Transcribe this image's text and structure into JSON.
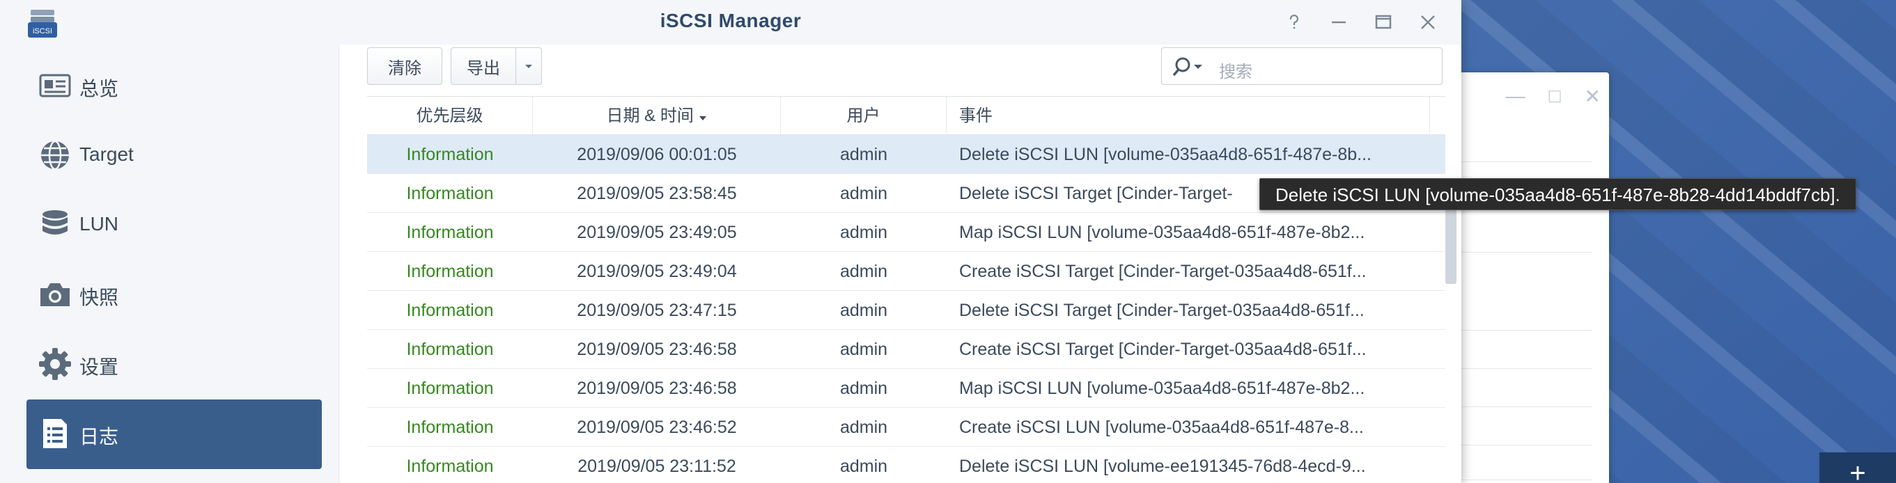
{
  "window": {
    "title": "iSCSI Manager",
    "app_icon_text": "iSCSI"
  },
  "sidebar": {
    "items": [
      {
        "label": "总览",
        "icon": "overview-card-icon"
      },
      {
        "label": "Target",
        "icon": "globe-icon"
      },
      {
        "label": "LUN",
        "icon": "database-icon"
      },
      {
        "label": "快照",
        "icon": "camera-icon"
      },
      {
        "label": "设置",
        "icon": "gear-icon"
      },
      {
        "label": "日志",
        "icon": "log-document-icon",
        "active": true
      }
    ]
  },
  "toolbar": {
    "clear_label": "清除",
    "export_label": "导出",
    "search_placeholder": "搜索"
  },
  "table": {
    "columns": [
      "优先层级",
      "日期 & 时间",
      "用户",
      "事件"
    ],
    "sort_column": "日期 & 时间",
    "rows": [
      {
        "priority": "Information",
        "time": "2019/09/06 00:01:05",
        "user": "admin",
        "event": "Delete iSCSI LUN [volume-035aa4d8-651f-487e-8b...",
        "selected": true
      },
      {
        "priority": "Information",
        "time": "2019/09/05 23:58:45",
        "user": "admin",
        "event": "Delete iSCSI Target [Cinder-Target-"
      },
      {
        "priority": "Information",
        "time": "2019/09/05 23:49:05",
        "user": "admin",
        "event": "Map iSCSI LUN [volume-035aa4d8-651f-487e-8b2..."
      },
      {
        "priority": "Information",
        "time": "2019/09/05 23:49:04",
        "user": "admin",
        "event": "Create iSCSI Target [Cinder-Target-035aa4d8-651f..."
      },
      {
        "priority": "Information",
        "time": "2019/09/05 23:47:15",
        "user": "admin",
        "event": "Delete iSCSI Target [Cinder-Target-035aa4d8-651f..."
      },
      {
        "priority": "Information",
        "time": "2019/09/05 23:46:58",
        "user": "admin",
        "event": "Create iSCSI Target [Cinder-Target-035aa4d8-651f..."
      },
      {
        "priority": "Information",
        "time": "2019/09/05 23:46:58",
        "user": "admin",
        "event": "Map iSCSI LUN [volume-035aa4d8-651f-487e-8b2..."
      },
      {
        "priority": "Information",
        "time": "2019/09/05 23:46:52",
        "user": "admin",
        "event": "Create iSCSI LUN [volume-035aa4d8-651f-487e-8..."
      },
      {
        "priority": "Information",
        "time": "2019/09/05 23:11:52",
        "user": "admin",
        "event": "Delete iSCSI LUN [volume-ee191345-76d8-4ecd-9..."
      }
    ]
  },
  "tooltip": {
    "text": "Delete iSCSI LUN [volume-035aa4d8-651f-487e-8b28-4dd14bddf7cb]."
  },
  "colors": {
    "accent": "#3a5e8c",
    "priority_info": "#35881f",
    "selected_row": "#dfeaf7"
  }
}
